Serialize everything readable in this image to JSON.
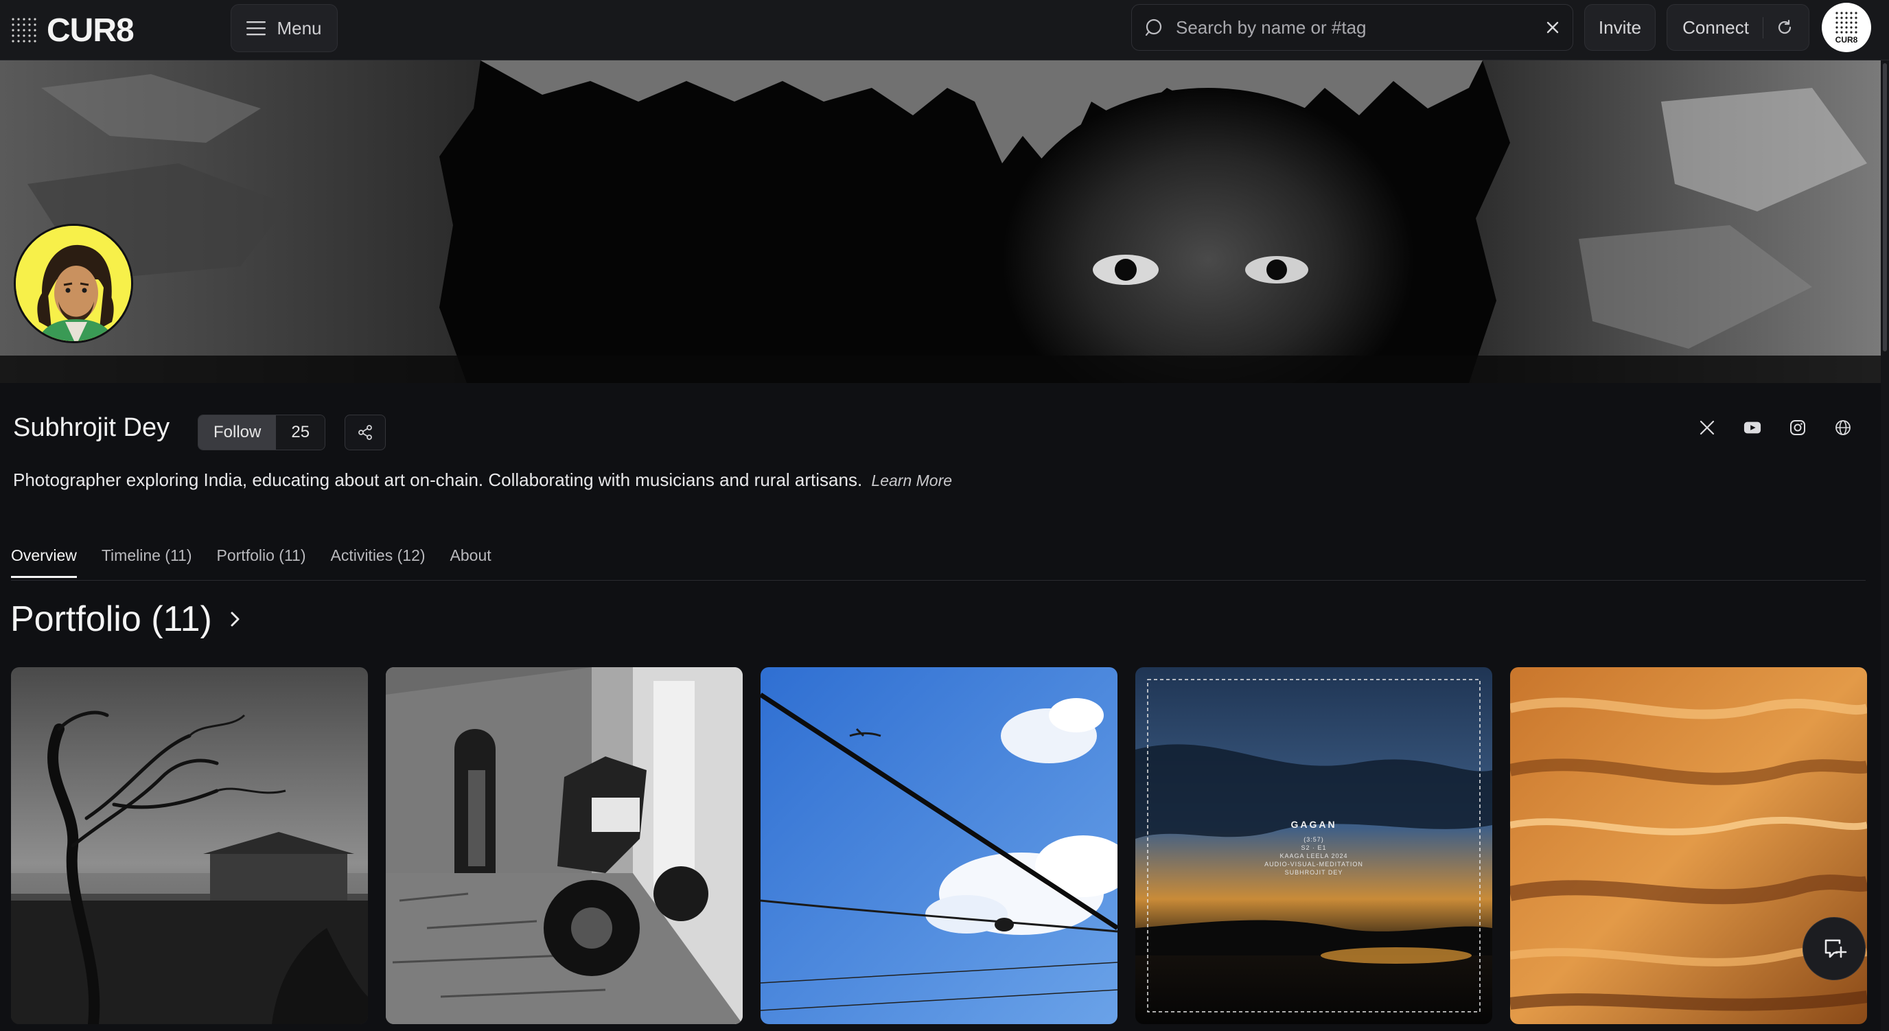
{
  "app": {
    "logo_text": "CUR8",
    "avatar_text": "CUR8"
  },
  "topbar": {
    "menu_label": "Menu",
    "search_placeholder": "Search by name or #tag",
    "invite_label": "Invite",
    "connect_label": "Connect"
  },
  "profile": {
    "name": "Subhrojit Dey",
    "follow_label": "Follow",
    "follower_count": "25",
    "bio": "Photographer exploring India, educating about art on-chain. Collaborating with musicians and rural artisans.",
    "learn_more": "Learn More",
    "socials": [
      "x-icon",
      "youtube-icon",
      "instagram-icon",
      "globe-icon"
    ]
  },
  "tabs": [
    {
      "label": "Overview",
      "active": true
    },
    {
      "label": "Timeline (11)"
    },
    {
      "label": "Portfolio (11)"
    },
    {
      "label": "Activities (12)"
    },
    {
      "label": "About"
    }
  ],
  "section": {
    "title": "Portfolio (11)"
  },
  "portfolio_cards": [
    {
      "subject": "bare-tree-bw"
    },
    {
      "subject": "scooter-archway-bw"
    },
    {
      "subject": "bird-on-wire-sky"
    },
    {
      "subject": "gagan-cover",
      "title": "GAGAN",
      "lines": [
        "(3:57)",
        "S2 · E1",
        "KAAGA LEELA 2024",
        "AUDIO-VISUAL-MEDITATION",
        "SUBHROJIT DEY"
      ]
    },
    {
      "subject": "golden-water"
    }
  ],
  "colors": {
    "background": "#0f1013",
    "topbar": "#17181b",
    "avatar_bg": "#f7f04a"
  }
}
